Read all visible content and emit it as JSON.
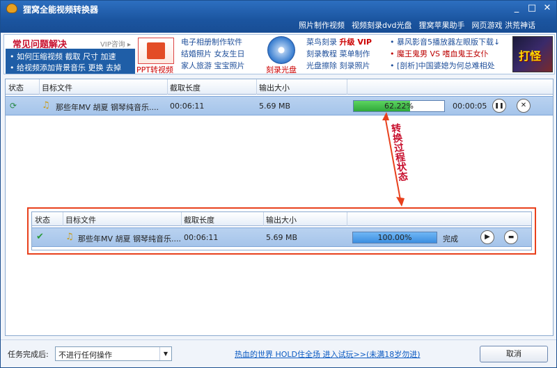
{
  "window": {
    "title": "狸窝全能视频转换器",
    "minimize": "_",
    "maximize": "□",
    "close": "✕"
  },
  "topnav": [
    "照片制作视频",
    "视频刻录dvd光盘",
    "狸窝苹果助手",
    "网页游戏 洪荒神话"
  ],
  "banner": {
    "faq_title": "常见问题解决",
    "vip": "VIP咨询 ▸",
    "faq_line1": "• 如何压缩视频  截取  尺寸  加速",
    "faq_line2": "• 给视频添加背景音乐  更换  去掉",
    "ppt_label": "PPT转视频",
    "photo_links": [
      "电子相册制作软件",
      "结婚照片  女友生日",
      "家人旅游  宝宝照片"
    ],
    "disc_label": "刻录光盘",
    "burn_links_1": "菜鸟刻录",
    "burn_upgrade": "升级 VIP",
    "burn_links": [
      "刻录教程  菜单制作",
      "光盘擦除  刻录照片"
    ],
    "news": [
      "• 暴风影音5播放器左眼版下载↓",
      "• 魔王鬼男  VS  嗜血鬼王女仆",
      "• [剖析]中国婆媳为何总难相处"
    ],
    "game_text": "打怪"
  },
  "columns": [
    "状态",
    "目标文件",
    "截取长度",
    "输出大小"
  ],
  "task_converting": {
    "file": "那些年MV 胡夏 钢琴纯音乐....",
    "duration": "00:06:11",
    "size": "5.69 MB",
    "progress_text": "62.22%",
    "progress": 0.6222,
    "remaining": "00:00:05",
    "pause": "❚❚",
    "cancel": "✕"
  },
  "annotation": "转换过程状态",
  "task_done": {
    "status_icon": "✔",
    "file": "那些年MV 胡夏 钢琴纯音乐....",
    "duration": "00:06:11",
    "size": "5.69 MB",
    "progress_text": "100.00%",
    "progress": 1.0,
    "done_label": "完成",
    "play": "▶",
    "folder": "▬"
  },
  "bottom": {
    "after_label": "任务完成后:",
    "after_value": "不进行任何操作",
    "ad_link": "热血的世界 HOLD住全场 进入试玩>>(未满18岁勿进)",
    "cancel_label": "取消"
  },
  "colors": {
    "progress_green": "#2fa83a",
    "progress_blue": "#3c8ee0",
    "annotation_red": "#e8401c"
  }
}
